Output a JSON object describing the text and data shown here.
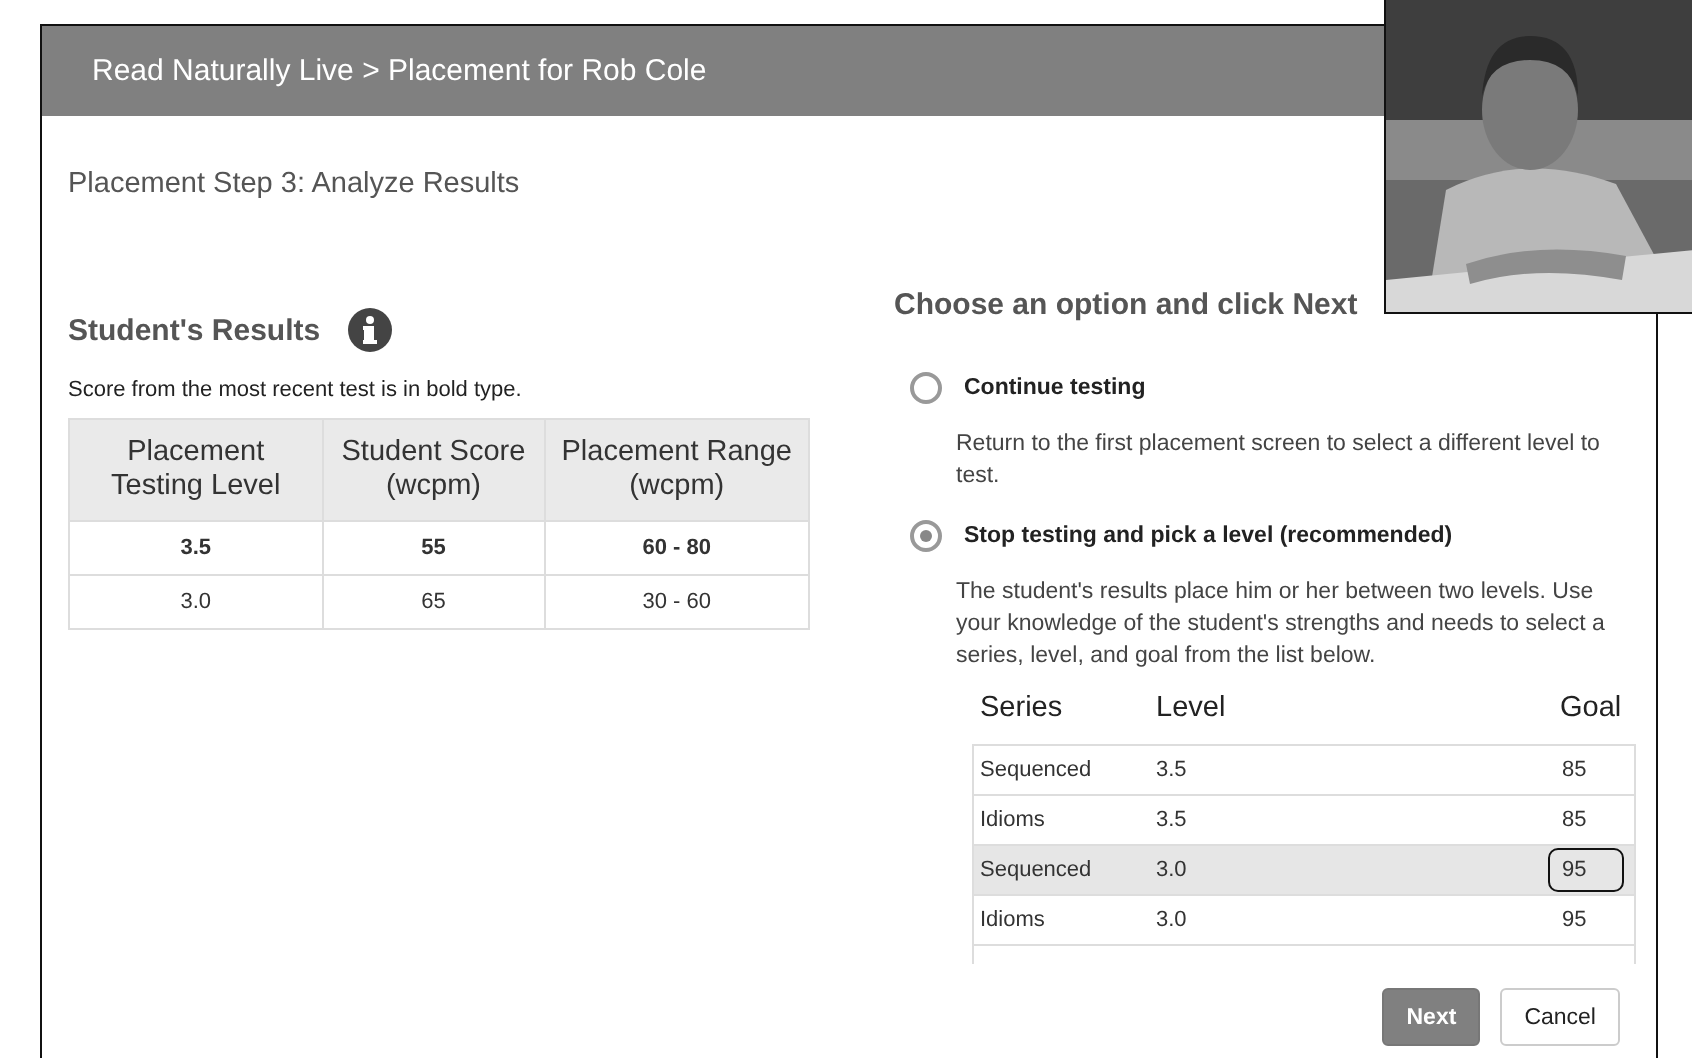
{
  "window": {
    "title": "Read Naturally Live > Placement for Rob Cole"
  },
  "step_title": "Placement Step 3: Analyze Results",
  "results": {
    "heading": "Student's Results",
    "note": "Score from the most recent test is in bold type.",
    "columns": [
      "Placement Testing Level",
      "Student Score (wcpm)",
      "Placement Range (wcpm)"
    ],
    "rows": [
      {
        "cells": [
          "3.5",
          "55",
          "60 - 80"
        ],
        "most_recent": true
      },
      {
        "cells": [
          "3.0",
          "65",
          "30 - 60"
        ],
        "most_recent": false
      }
    ]
  },
  "options": {
    "heading": "Choose an option and click Next",
    "items": [
      {
        "label": "Continue testing",
        "description": "Return to the first placement screen to select a different level to test.",
        "selected": false
      },
      {
        "label": "Stop testing and pick a level (recommended)",
        "description": "The student's results place him or her between two levels. Use your knowledge of the student's strengths and needs to select a series, level, and goal from the list below.",
        "selected": true
      }
    ]
  },
  "levels": {
    "columns": [
      "Series",
      "Level",
      "Goal"
    ],
    "rows": [
      {
        "cells": [
          "Sequenced",
          "3.5",
          "85"
        ],
        "selected": false,
        "goal_marked": false
      },
      {
        "cells": [
          "Idioms",
          "3.5",
          "85"
        ],
        "selected": false,
        "goal_marked": false
      },
      {
        "cells": [
          "Sequenced",
          "3.0",
          "95"
        ],
        "selected": true,
        "goal_marked": true
      },
      {
        "cells": [
          "Idioms",
          "3.0",
          "95"
        ],
        "selected": false,
        "goal_marked": false
      }
    ]
  },
  "buttons": [
    {
      "label": "Next",
      "kind": "primary"
    },
    {
      "label": "Cancel",
      "kind": "secondary"
    }
  ]
}
